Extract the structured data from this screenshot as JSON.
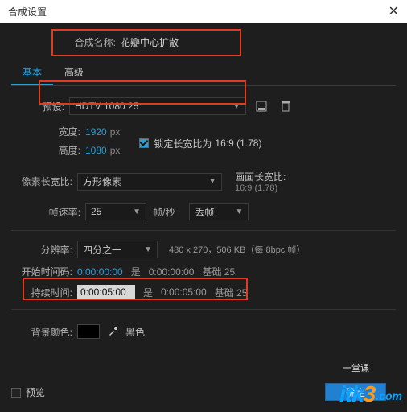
{
  "window": {
    "title": "合成设置"
  },
  "nameRow": {
    "label": "合成名称:",
    "value": "花瓣中心扩散"
  },
  "tabs": {
    "basic": "基本",
    "advanced": "高级"
  },
  "preset": {
    "label": "预设:",
    "value": "HDTV 1080 25"
  },
  "width": {
    "label": "宽度:",
    "value": "1920",
    "unit": "px"
  },
  "height": {
    "label": "高度:",
    "value": "1080",
    "unit": "px"
  },
  "lock": {
    "label": "锁定长宽比为",
    "ratio": "16:9 (1.78)"
  },
  "par": {
    "label": "像素长宽比:",
    "value": "方形像素",
    "rightLabel": "画面长宽比:",
    "rightValue": "16:9 (1.78)"
  },
  "fps": {
    "label": "帧速率:",
    "value": "25",
    "unit": "帧/秒",
    "drop": "丢帧"
  },
  "res": {
    "label": "分辨率:",
    "value": "四分之一",
    "info": "480 x 270，506 KB（每 8bpc 帧）"
  },
  "start": {
    "label": "开始时间码:",
    "value": "0:00:00:00",
    "is": "是",
    "isValue": "0:00:00:00",
    "base": "基础 25"
  },
  "duration": {
    "label": "持续时间:",
    "value": "0:00:05:00",
    "is": "是",
    "isValue": "0:00:05:00",
    "base": "基础 25"
  },
  "bg": {
    "label": "背景颜色:",
    "name": "黑色"
  },
  "preview": {
    "label": "预览"
  },
  "ok": {
    "label": "确定"
  },
  "watermark": {
    "brand": "itk",
    "num": "3",
    "dot": ".com",
    "tag": "一堂课"
  }
}
